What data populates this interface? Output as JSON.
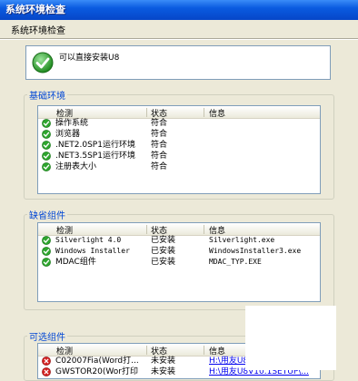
{
  "window": {
    "title": "系统环境检查"
  },
  "header": {
    "label": "系统环境检查"
  },
  "status": {
    "message": "可以直接安装U8"
  },
  "columns": {
    "check": "检测",
    "state": "状态",
    "info": "信息"
  },
  "basic": {
    "title": "基础环境",
    "rows": [
      {
        "name": "操作系统",
        "state": "符合",
        "info": ""
      },
      {
        "name": "浏览器",
        "state": "符合",
        "info": ""
      },
      {
        "name": ".NET2.0SP1运行环境",
        "state": "符合",
        "info": ""
      },
      {
        "name": ".NET3.5SP1运行环境",
        "state": "符合",
        "info": ""
      },
      {
        "name": "注册表大小",
        "state": "符合",
        "info": ""
      }
    ]
  },
  "default_components": {
    "title": "缺省组件",
    "rows": [
      {
        "name": "Silverlight 4.0",
        "state": "已安装",
        "info": "Silverlight.exe"
      },
      {
        "name": "Windows Installer",
        "state": "已安装",
        "info": "WindowsInstaller3.exe"
      },
      {
        "name": "MDAC组件",
        "state": "已安装",
        "info": "MDAC_TYP.EXE"
      }
    ]
  },
  "optional_components": {
    "title": "可选组件",
    "rows": [
      {
        "name": "C02007Fia(Word打...",
        "state": "未安装",
        "info": "H:\\用友U8V10.1SETUP\\..."
      },
      {
        "name": "GWSTOR20(Wor打印",
        "state": "未安装",
        "info": "H:\\用友U8V10.1SETUP\\..."
      }
    ]
  },
  "icons": {
    "ok": "green-check-icon",
    "error": "red-x-icon"
  },
  "colors": {
    "ok": "#2EA52E",
    "error": "#D42020",
    "group_title": "#0046D5"
  }
}
